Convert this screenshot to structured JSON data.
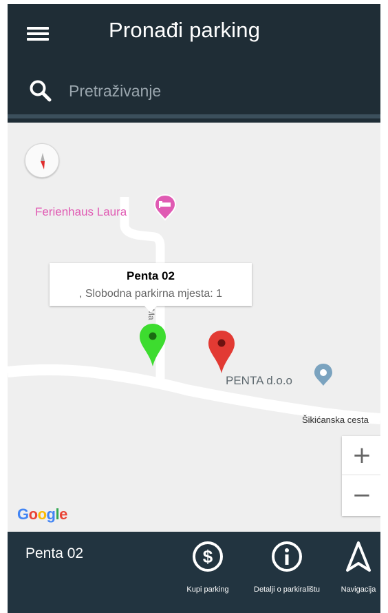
{
  "header": {
    "title": "Pronađi parking",
    "menu_icon": "menu-icon"
  },
  "search": {
    "placeholder": "Pretraživanje",
    "icon": "search-icon"
  },
  "map": {
    "compass_icon": "compass-icon",
    "poi_hotel": "Ferienhaus Laura",
    "poi_company": "PENTA d.o.o",
    "road_name": "Šikićanska cesta",
    "road_name_vertical": "Ma",
    "info_window": {
      "title": "Penta 02",
      "subtitle": ", Slobodna parkirna mjesta: 1"
    },
    "markers": [
      {
        "name": "Penta 02",
        "color": "#3ddc2f",
        "state": "selected"
      },
      {
        "name": "parking",
        "color": "#e23a33",
        "state": "unselected"
      }
    ],
    "zoom_in": "+",
    "zoom_out": "−",
    "attribution": "Google"
  },
  "bottom": {
    "selected_name": "Penta 02",
    "actions": [
      {
        "label": "Kupi parking",
        "icon": "dollar-circle-icon"
      },
      {
        "label": "Detalji o parkiralištu",
        "icon": "info-circle-icon"
      },
      {
        "label": "Navigacija",
        "icon": "navigation-arrow-icon"
      }
    ]
  },
  "colors": {
    "app_bar": "#1f2d36",
    "bottom_bar": "#223440",
    "map_bg": "#efefef",
    "hotel_pink": "#e05bb3"
  }
}
